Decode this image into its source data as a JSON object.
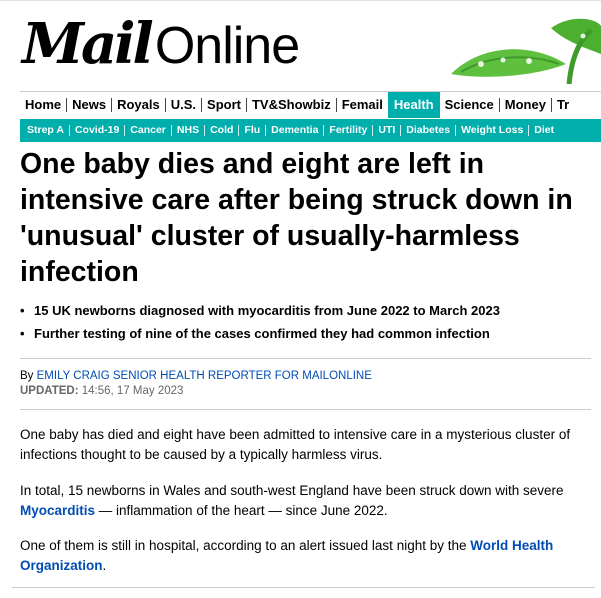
{
  "brand": {
    "mail": "Mail",
    "online": "Online"
  },
  "nav": {
    "items": [
      "Home",
      "News",
      "Royals",
      "U.S.",
      "Sport",
      "TV&Showbiz",
      "Femail",
      "Health",
      "Science",
      "Money",
      "Tr"
    ],
    "active": "Health"
  },
  "subnav": {
    "items": [
      "Strep A",
      "Covid-19",
      "Cancer",
      "NHS",
      "Cold",
      "Flu",
      "Dementia",
      "Fertility",
      "UTI",
      "Diabetes",
      "Weight Loss",
      "Diet"
    ]
  },
  "article": {
    "headline": "One baby dies and eight are left in intensive care after being struck down in 'unusual' cluster of usually-harmless infection",
    "bullets": [
      "15 UK newborns diagnosed with myocarditis from June 2022 to March 2023",
      "Further testing of nine of the cases confirmed they had common infection"
    ],
    "byline_prefix": "By ",
    "author": "EMILY CRAIG SENIOR HEALTH REPORTER FOR MAILONLINE",
    "updated_label": "UPDATED:",
    "updated_value": " 14:56, 17 May 2023",
    "p1": "One baby has died and eight have been admitted to intensive care in a mysterious cluster of infections thought to be caused by a typically harmless virus.",
    "p2_before": "In total, 15 newborns in Wales and south-west England have been struck down with severe ",
    "p2_link": "Myocarditis",
    "p2_after": " — inflammation of the heart — since June 2022.",
    "p3_before": "One of them is still in hospital, according to an alert issued last night by the ",
    "p3_link": "World Health Organization",
    "p3_after": "."
  },
  "colors": {
    "accent": "#00aeac",
    "link": "#004db3"
  }
}
